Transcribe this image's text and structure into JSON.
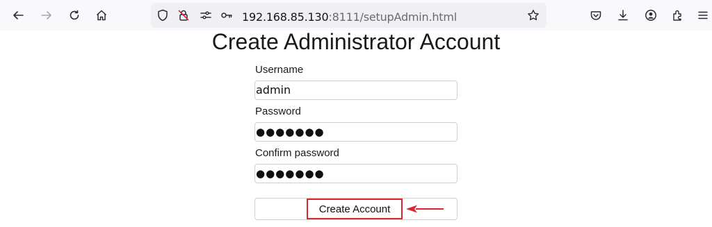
{
  "browser": {
    "url_host": "192.168.85.130",
    "url_rest": ":8111/setupAdmin.html"
  },
  "page": {
    "title": "Create Administrator Account",
    "username_label": "Username",
    "username_value": "admin",
    "password_label": "Password",
    "password_value": "●●●●●●●",
    "confirm_label": "Confirm password",
    "confirm_value": "●●●●●●●",
    "submit_label": "Create Account"
  },
  "colors": {
    "highlight": "#d9262c"
  },
  "icons": [
    "back-icon",
    "forward-icon",
    "reload-icon",
    "home-icon",
    "shield-icon",
    "no-tracking-icon",
    "permissions-icon",
    "key-icon",
    "bookmark-star-icon",
    "pocket-icon",
    "download-icon",
    "account-icon",
    "extensions-icon",
    "menu-icon"
  ]
}
